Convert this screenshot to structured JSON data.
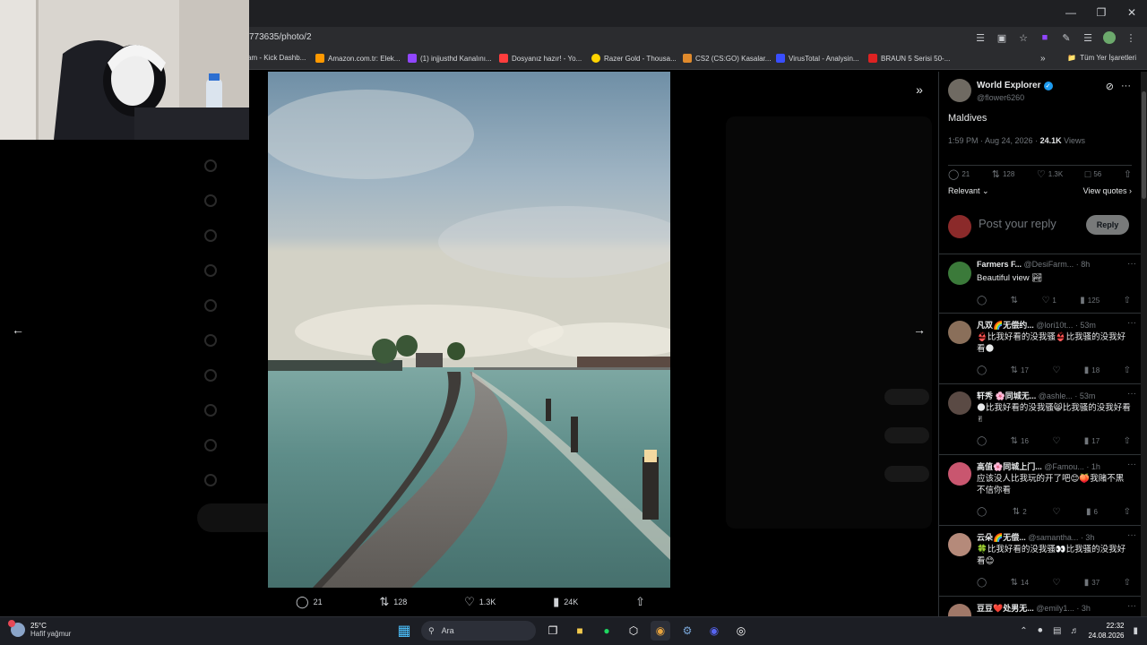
{
  "browser": {
    "url_partial": "773635/photo/2",
    "bookmarks": [
      {
        "label": "am - Kick Dashb...",
        "color": "#53fc18"
      },
      {
        "label": "Amazon.com.tr: Elek...",
        "color": "#ff9900"
      },
      {
        "label": "(1) injjusthd Kanalını...",
        "color": "#9146ff"
      },
      {
        "label": "Dosyanız hazır! - Yo...",
        "color": "#ff3d3d"
      },
      {
        "label": "Razer Gold - Thousa...",
        "color": "#ffd400"
      },
      {
        "label": "CS2 (CS:GO) Kasalar...",
        "color": "#e08a2c"
      },
      {
        "label": "VirusTotal - Analysin...",
        "color": "#394eff"
      },
      {
        "label": "BRAUN 5 Serisi 50-...",
        "color": "#d22"
      }
    ],
    "all_bookmarks": "Tüm Yer İşaretleri"
  },
  "photo_actions": {
    "replies": "21",
    "reposts": "128",
    "likes": "1.3K",
    "views": "24K"
  },
  "tweet": {
    "author_name": "World Explorer",
    "author_handle": "@flower6260",
    "text": "Maldives",
    "time": "1:59 PM · Aug 24, 2026 · ",
    "views_count": "24.1K",
    "views_label": " Views",
    "stats": {
      "replies": "21",
      "reposts": "128",
      "likes": "1.3K",
      "bookmarks": "56"
    },
    "sort": "Relevant",
    "view_quotes": "View quotes",
    "reply_placeholder": "Post your reply",
    "reply_button": "Reply"
  },
  "replies": [
    {
      "name": "Farmers F...",
      "handle": "@DesiFarm...",
      "time": "· 8h",
      "text": "Beautiful view 🏞",
      "reply": "",
      "repost": "",
      "like": "1",
      "views": "125",
      "avatar": "#3b7a3a"
    },
    {
      "name": "凡双🌈无偿约...",
      "handle": "@lori10t...",
      "time": "· 53m",
      "text": "👙比我好看的没我骚👙比我骚的没我好看🌑",
      "reply": "",
      "repost": "17",
      "like": "",
      "views": "18",
      "avatar": "#8a6f5a"
    },
    {
      "name": "轩秀 🌸同城无...",
      "handle": "@ashle...",
      "time": "· 53m",
      "text": "🌑比我好看的没我骚😸比我骚的没我好看✌",
      "reply": "",
      "repost": "16",
      "like": "",
      "views": "17",
      "avatar": "#5a4a44"
    },
    {
      "name": "高值🌸同城上门...",
      "handle": "@Famou...",
      "time": "· 1h",
      "text": "应该没人比我玩的开了吧😊🍑我赌不黑不信你看",
      "reply": "",
      "repost": "2",
      "like": "",
      "views": "6",
      "avatar": "#c9566f"
    },
    {
      "name": "云朵🌈无偿...",
      "handle": "@samantha...",
      "time": "· 3h",
      "text": "🍀比我好看的没我骚👀比我骚的没我好看😊",
      "reply": "",
      "repost": "14",
      "like": "",
      "views": "37",
      "avatar": "#b58a7a"
    },
    {
      "name": "豆豆❤️处男无...",
      "handle": "@emily1...",
      "time": "· 3h",
      "text": "",
      "reply": "",
      "repost": "",
      "like": "",
      "views": "",
      "avatar": "#a07868"
    }
  ],
  "taskbar": {
    "temp": "25°C",
    "weather": "Hafif yağmur",
    "search": "Ara",
    "time": "22:32",
    "date": "24.08.2026"
  },
  "colors": {
    "accent": "#1d9bf0",
    "background": "#000000",
    "muted": "#71767b"
  }
}
